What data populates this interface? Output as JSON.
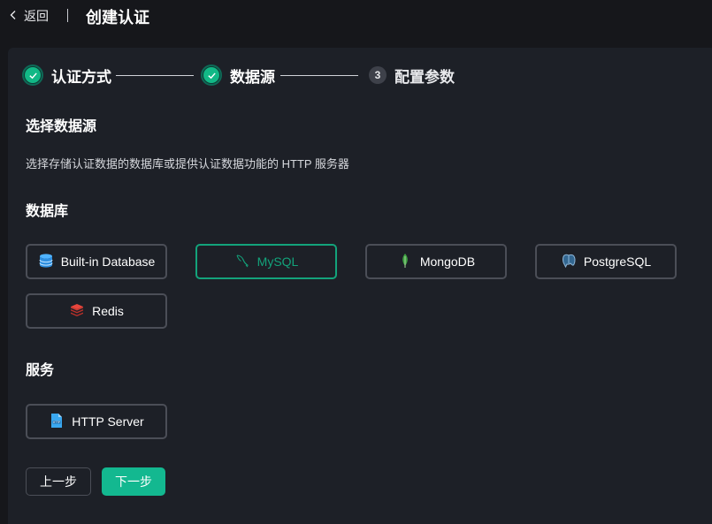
{
  "header": {
    "back_label": "返回",
    "title": "创建认证"
  },
  "steps": [
    {
      "number": "1",
      "label": "认证方式",
      "status": "done"
    },
    {
      "number": "2",
      "label": "数据源",
      "status": "done"
    },
    {
      "number": "3",
      "label": "配置参数",
      "status": "pending"
    }
  ],
  "main": {
    "section_title": "选择数据源",
    "description": "选择存储认证数据的数据库或提供认证数据功能的 HTTP 服务器",
    "database_heading": "数据库",
    "databases": [
      {
        "label": "Built-in Database",
        "icon": "database-icon",
        "selected": false
      },
      {
        "label": "MySQL",
        "icon": "mysql-dolphin-icon",
        "selected": true
      },
      {
        "label": "MongoDB",
        "icon": "mongodb-leaf-icon",
        "selected": false
      },
      {
        "label": "PostgreSQL",
        "icon": "postgresql-elephant-icon",
        "selected": false
      },
      {
        "label": "Redis",
        "icon": "redis-cube-icon",
        "selected": false
      }
    ],
    "service_heading": "服务",
    "services": [
      {
        "label": "HTTP Server",
        "icon": "http-file-icon",
        "selected": false
      }
    ]
  },
  "actions": {
    "prev_label": "上一步",
    "next_label": "下一步"
  },
  "colors": {
    "accent": "#13b890",
    "background": "#16171b",
    "panel": "#1d2027",
    "card_border": "#4b4e57"
  }
}
